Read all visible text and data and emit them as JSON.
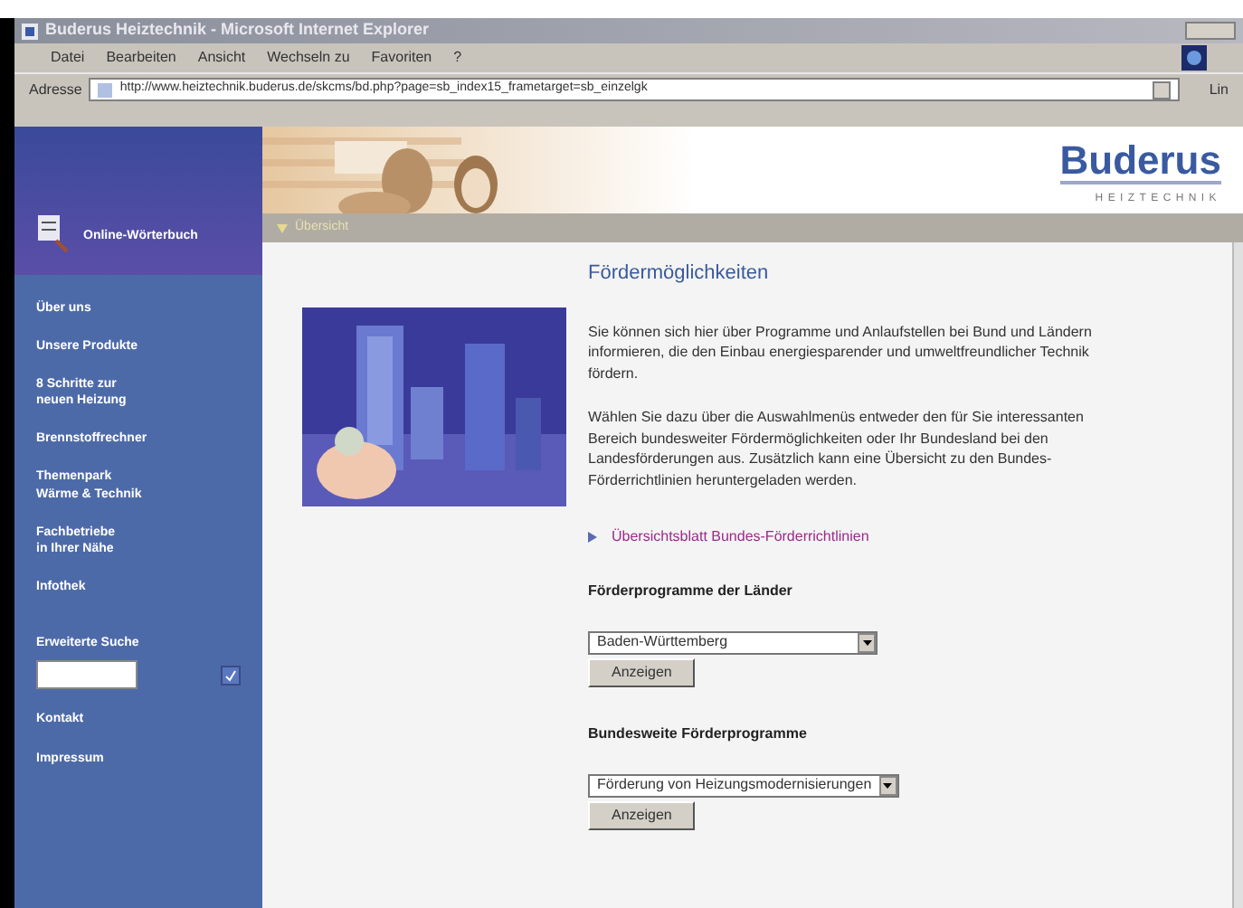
{
  "window": {
    "title": "Buderus Heiztechnik - Microsoft Internet Explorer"
  },
  "menu": [
    "Datei",
    "Bearbeiten",
    "Ansicht",
    "Wechseln zu",
    "Favoriten",
    "?"
  ],
  "address_bar": {
    "label": "Adresse",
    "value": "http://www.heiztechnik.buderus.de/skcms/bd.php?page=sb_index15_frametarget=sb_einzelgk",
    "links": "Lin"
  },
  "logo": {
    "name": "Buderus",
    "tagline": "HEIZTECHNIK"
  },
  "sidebar": {
    "dictionary": "Online-Wörterbuch",
    "items": [
      {
        "label": "Über uns"
      },
      {
        "label": "Unsere Produkte"
      },
      {
        "label": "8 Schritte zur\nneuen Heizung"
      },
      {
        "label": "Brennstoffrechner"
      },
      {
        "label": "Themenpark\nWärme & Technik"
      },
      {
        "label": "Fachbetriebe\nin Ihrer Nähe"
      },
      {
        "label": "Infothek"
      }
    ],
    "search": {
      "label": "Erweiterte Suche"
    },
    "bottom_items": [
      {
        "label": "Kontakt"
      },
      {
        "label": "Impressum"
      }
    ]
  },
  "breadcrumb": "Übersicht",
  "content": {
    "title": "Fördermöglichkeiten",
    "paragraphs": [
      "Sie können sich hier über Programme und Anlaufstellen bei Bund und Ländern informieren, die den Einbau energiesparender und umweltfreundlicher Technik fördern.",
      "Wählen Sie dazu über die Auswahlmenüs entweder den für Sie interessanten Bereich bundesweiter Fördermöglichkeiten oder Ihr Bundesland bei den Landesförderungen aus. Zusätzlich kann eine Übersicht zu den Bundes-Förderrichtlinien heruntergeladen werden."
    ],
    "link": "Übersichtsblatt Bundes-Förderrichtlinien",
    "sections": [
      {
        "heading": "Förderprogramme der Länder",
        "select": "Baden-Württemberg",
        "button": "Anzeigen"
      },
      {
        "heading": "Bundesweite Förderprogramme",
        "select": "Förderung von Heizungsmodernisierungen",
        "button": "Anzeigen"
      }
    ]
  }
}
